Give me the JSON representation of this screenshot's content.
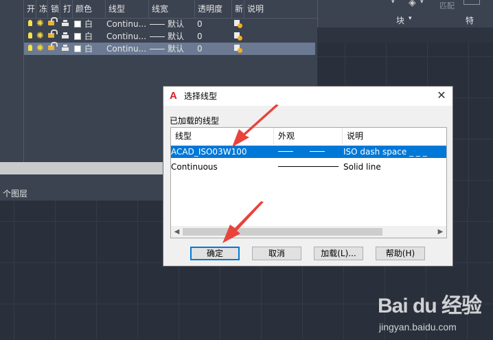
{
  "layer_manager": {
    "columns": [
      "开",
      "冻",
      "锁",
      "打",
      "颜色",
      "线型",
      "线宽",
      "透明度",
      "新",
      "说明"
    ],
    "rows": [
      {
        "color": "白",
        "linetype": "Continu...",
        "lineweight": "默认",
        "transparency": "0"
      },
      {
        "color": "白",
        "linetype": "Continu...",
        "lineweight": "默认",
        "transparency": "0"
      },
      {
        "color": "白",
        "linetype": "Continu...",
        "lineweight": "默认",
        "transparency": "0"
      }
    ],
    "selected_row": 2,
    "status_text": "个图层"
  },
  "ribbon": {
    "block_label": "块",
    "match_label": "匹配",
    "special_label": "特"
  },
  "dialog": {
    "title": "选择线型",
    "logo_letter": "A",
    "close_glyph": "✕",
    "loaded_label": "已加载的线型",
    "list": {
      "columns": [
        "线型",
        "外观",
        "说明"
      ],
      "rows": [
        {
          "linetype": "ACAD_ISO03W100",
          "description": "ISO dash space _ _ _"
        },
        {
          "linetype": "Continuous",
          "description": "Solid line"
        }
      ],
      "selected_row": 0
    },
    "buttons": {
      "ok": "确定",
      "cancel": "取消",
      "load": "加载(L)...",
      "help": "帮助(H)"
    }
  },
  "watermark": {
    "logo": "Bai du 经验",
    "url": "jingyan.baidu.com"
  },
  "colors": {
    "annotation_arrow": "#e8443b",
    "selection_blue": "#0078d7",
    "panel_bg": "#3b4250"
  }
}
